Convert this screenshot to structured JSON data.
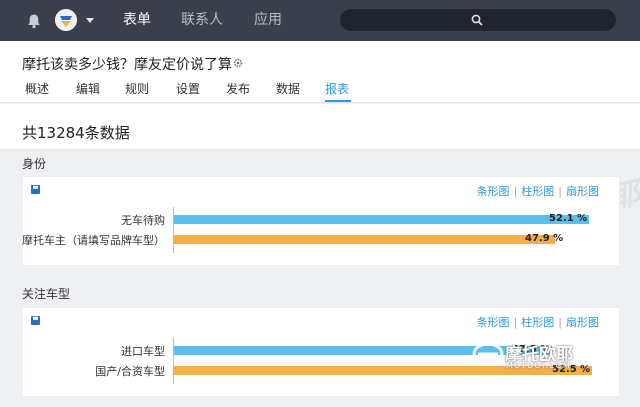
{
  "nav": {
    "items": [
      "表单",
      "联系人",
      "应用"
    ],
    "active_index": 0
  },
  "header": {
    "title": "摩托该卖多少钱？摩友定价说了算",
    "tabs": [
      "概述",
      "编辑",
      "规则",
      "设置",
      "发布",
      "数据",
      "报表"
    ],
    "active_tab": "报表"
  },
  "summary": {
    "count_text": "共13284条数据"
  },
  "sections": [
    {
      "label": "身份",
      "links": [
        "条形图",
        "柱形图",
        "扇形图"
      ],
      "chart_data": {
        "type": "bar",
        "orientation": "horizontal",
        "categories": [
          "无车待购",
          "摩托车主（请填写品牌车型）"
        ],
        "values": [
          52.1,
          47.9
        ],
        "value_labels": [
          "52.1 %",
          "47.9 %"
        ],
        "unit": "%",
        "colors": [
          "#5bc0ec",
          "#f5ae48"
        ]
      }
    },
    {
      "label": "关注车型",
      "links": [
        "条形图",
        "柱形图",
        "扇形图"
      ],
      "chart_data": {
        "type": "bar",
        "orientation": "horizontal",
        "categories": [
          "进口车型",
          "国产/合资车型"
        ],
        "values": [
          47.5,
          52.5
        ],
        "value_labels": [
          "47.5 %",
          "52.5 %"
        ],
        "unit": "%",
        "colors": [
          "#5bc0ec",
          "#f5ae48"
        ]
      }
    }
  ],
  "watermark": {
    "brand": "摩托欧耶",
    "domain": "MOTOOY.COM"
  },
  "colors": {
    "topbar": "#3a3f4b",
    "accent": "#2a9be0",
    "bar_blue": "#5bc0ec",
    "bar_orange": "#f5ae48"
  },
  "icons": [
    "bell-icon",
    "avatar",
    "chevron-down-icon",
    "search-icon",
    "gear-icon",
    "save-icon"
  ]
}
